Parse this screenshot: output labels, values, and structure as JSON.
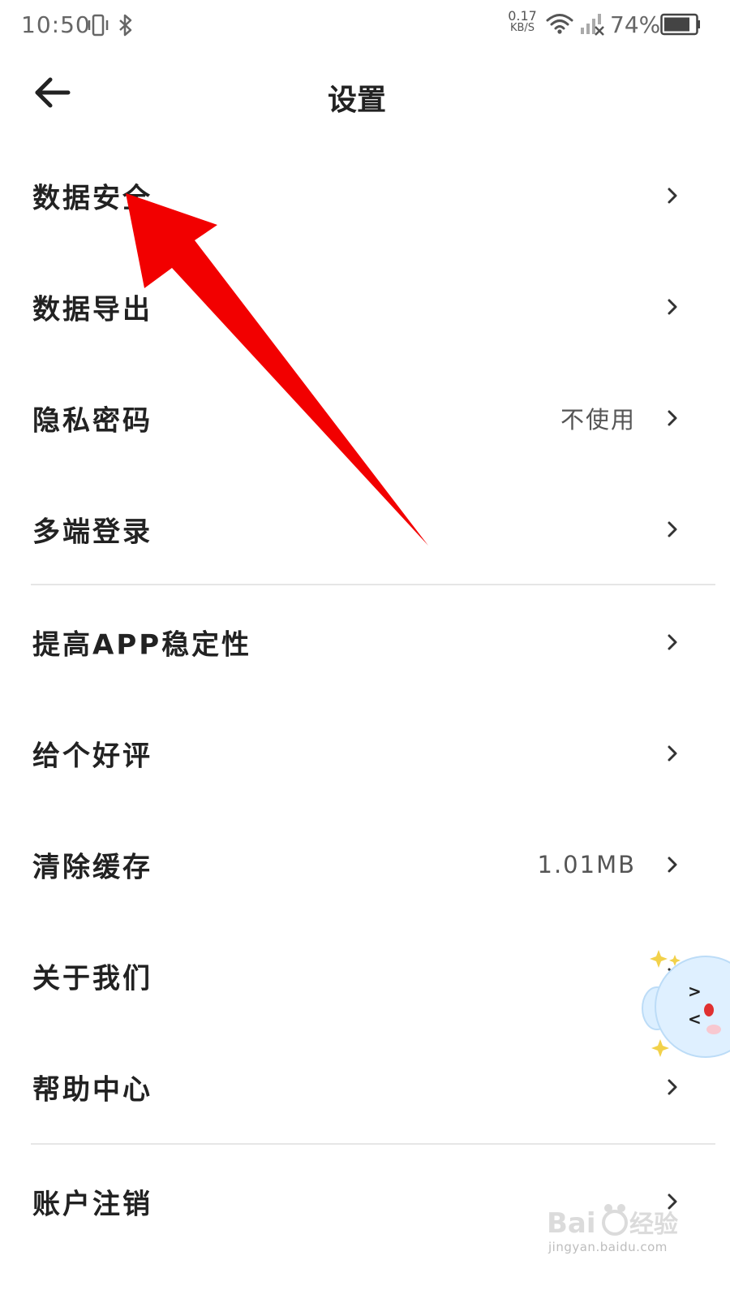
{
  "status_bar": {
    "time": "10:50",
    "net_speed_value": "0.17",
    "net_speed_unit": "KB/S",
    "battery_percent": "74%",
    "icons": [
      "vibrate-icon",
      "bluetooth-icon",
      "wifi-icon",
      "signal-no-service-icon",
      "battery-icon"
    ]
  },
  "header": {
    "title": "设置",
    "back_icon": "back-arrow-icon"
  },
  "settings": {
    "items": [
      {
        "label": "数据安全",
        "value": ""
      },
      {
        "label": "数据导出",
        "value": ""
      },
      {
        "label": "隐私密码",
        "value": "不使用"
      },
      {
        "label": "多端登录",
        "value": ""
      },
      {
        "label": "提高APP稳定性",
        "value": ""
      },
      {
        "label": "给个好评",
        "value": ""
      },
      {
        "label": "清除缓存",
        "value": "1.01MB"
      },
      {
        "label": "关于我们",
        "value": ""
      },
      {
        "label": "帮助中心",
        "value": ""
      },
      {
        "label": "账户注销",
        "value": ""
      }
    ]
  },
  "annotation": {
    "arrow_color": "#f20000"
  },
  "watermark": {
    "brand": "Baidu经验",
    "url": "jingyan.baidu.com"
  },
  "colors": {
    "text_primary": "#222222",
    "text_secondary": "#555555",
    "divider": "#e6e6e6",
    "background": "#ffffff"
  }
}
